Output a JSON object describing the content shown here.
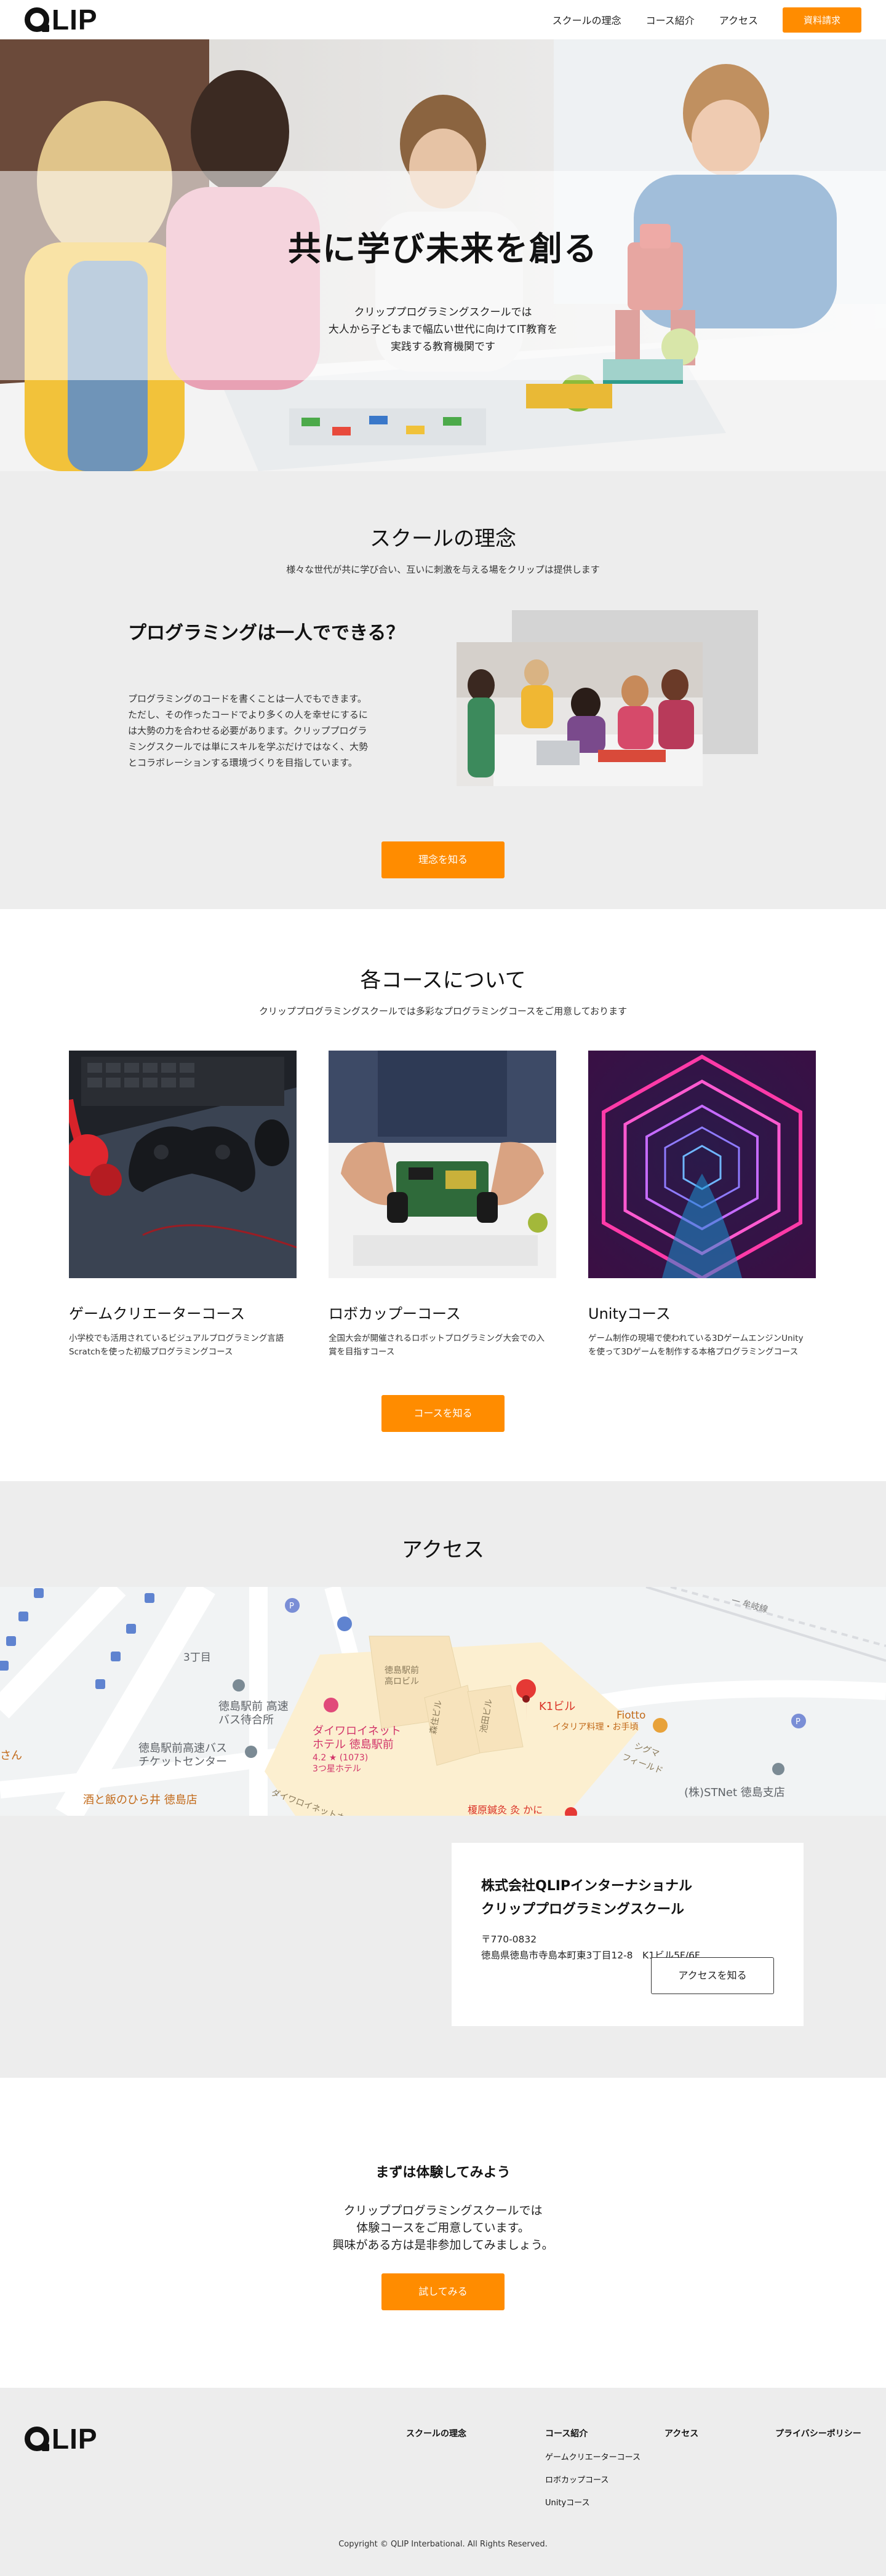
{
  "header": {
    "logo_text": "LIP",
    "nav": [
      "スクールの理念",
      "コース紹介",
      "アクセス"
    ],
    "cta_label": "資料請求"
  },
  "hero": {
    "title": "共に学び未来を創る",
    "subtitle_lines": [
      "クリッププログラミングスクールでは",
      "大人から子どもまで幅広い世代に向けてIT教育を",
      "実践する教育機関です"
    ]
  },
  "philosophy": {
    "title": "スクールの理念",
    "subtitle": "様々な世代が共に学び合い、互いに刺激を与える場をクリップは提供します",
    "heading": "プログラミングは一人でできる？",
    "body_lines": [
      "プログラミングのコードを書くことは一人でもできます。",
      "ただし、その作ったコードでより多くの人を幸せにするに",
      "は大勢の力を合わせる必要があります。クリッププログラ",
      "ミングスクールでは単にスキルを学ぶだけではなく、大勢",
      "とコラボレーションする環境づくりを目指しています。"
    ],
    "button_label": "理念を知る"
  },
  "courses": {
    "title": "各コースについて",
    "subtitle": "クリッププログラミングスクールでは多彩なプログラミングコースをご用意しております",
    "items": [
      {
        "name": "ゲームクリエーターコース",
        "desc_lines": [
          "小学校でも活用されているビジュアルプログラミング言語",
          "Scratchを使った初級プログラミングコース"
        ]
      },
      {
        "name": "ロボカップーコース",
        "desc_lines": [
          "全国大会が開催されるロボットプログラミング大会での入",
          "賞を目指すコース"
        ]
      },
      {
        "name": "Unityコース",
        "desc_lines": [
          "ゲーム制作の現場で使われている3DゲームエンジンUnity",
          "を使って3Dゲームを制作する本格プログラミングコース"
        ]
      }
    ],
    "button_label": "コースを知る"
  },
  "access": {
    "title": "アクセス",
    "map_labels": {
      "ichome": "3丁目",
      "hotel1": "ダイワロイネット",
      "hotel1b": "ホテル 徳島駅前",
      "rating": "4.2 ★ (1073)",
      "stars": "3つ星ホテル",
      "k1": "K1ビル",
      "fiotto": "Fiotto",
      "italian": "イタリア料理・お手頃",
      "bus1": "徳島駅前 高速",
      "bus1b": "バス待合所",
      "bus2": "徳島駅前高速バス",
      "bus2b": "チケットセンター",
      "sake": "酒と飯のひら井 徳島店",
      "stnet": "(株)STNet 徳島支店",
      "ekimae": "徳島駅前",
      "ekimae2": "高ロビル",
      "mori": "森住ビル",
      "ikeda": "池田ビル",
      "sigma1": "シグマ",
      "sigma2": "フィールド",
      "daiwa_road": "ダイワロイネットホテ",
      "bottom": "榎原鍼灸 灸 かに",
      "san": "さん",
      "rail": "一 牟岐線"
    },
    "company_lines": [
      "株式会社QLIPインターナショナル",
      "クリッププログラミングスクール"
    ],
    "postal": "〒770-0832",
    "address": "徳島県徳島市寺島本町東3丁目12-8　K1ビル5F/6F",
    "button_label": "アクセスを知る"
  },
  "trial": {
    "title": "まずは体験してみよう",
    "body_lines": [
      "クリッププログラミングスクールでは",
      "体験コースをご用意しています。",
      "興味がある方は是非参加してみましょう。"
    ],
    "button_label": "試してみる"
  },
  "footer": {
    "logo_text": "LIP",
    "col1": "スクールの理念",
    "col2": "コース紹介",
    "col2_items": [
      "ゲームクリエーターコース",
      "ロボカップコース",
      "Unityコース"
    ],
    "col3": "アクセス",
    "col4": "プライバシーポリシー",
    "copyright": "Copyright © QLIP Interbational. All Rights Reserved."
  },
  "colors": {
    "accent": "#ff8c00",
    "section_grey": "#ededed"
  }
}
